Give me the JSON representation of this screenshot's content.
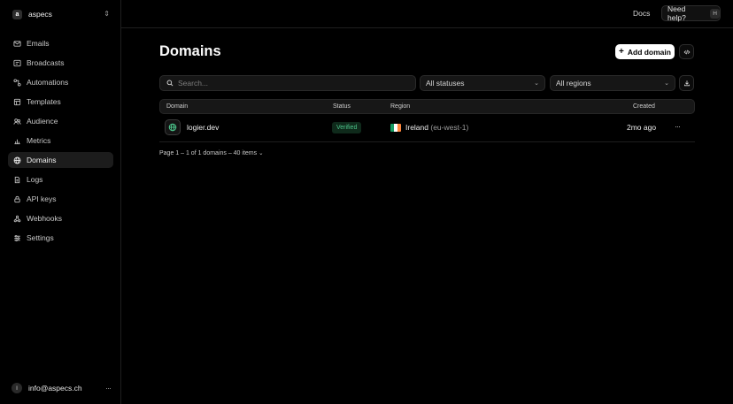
{
  "workspace": {
    "initial": "a",
    "name": "aspecs"
  },
  "sidebar": {
    "items": [
      {
        "label": "Emails",
        "icon": "mail-icon"
      },
      {
        "label": "Broadcasts",
        "icon": "broadcast-icon"
      },
      {
        "label": "Automations",
        "icon": "automation-icon"
      },
      {
        "label": "Templates",
        "icon": "template-icon"
      },
      {
        "label": "Audience",
        "icon": "users-icon"
      },
      {
        "label": "Metrics",
        "icon": "chart-icon"
      },
      {
        "label": "Domains",
        "icon": "globe-icon",
        "active": true
      },
      {
        "label": "Logs",
        "icon": "log-icon"
      },
      {
        "label": "API keys",
        "icon": "lock-icon"
      },
      {
        "label": "Webhooks",
        "icon": "webhook-icon"
      },
      {
        "label": "Settings",
        "icon": "sliders-icon"
      }
    ]
  },
  "user": {
    "initial": "I",
    "email": "info@aspecs.ch",
    "more": "···"
  },
  "header": {
    "docs": "Docs",
    "help": "Need help?",
    "help_key": "H"
  },
  "page": {
    "title": "Domains",
    "add_label": "Add domain",
    "search_placeholder": "Search...",
    "status_filter": "All statuses",
    "region_filter": "All regions"
  },
  "table": {
    "columns": {
      "domain": "Domain",
      "status": "Status",
      "region": "Region",
      "created": "Created"
    },
    "rows": [
      {
        "domain": "logier.dev",
        "status": "Verified",
        "region": "Ireland",
        "region_code": "(eu-west-1)",
        "created": "2mo ago",
        "more": "···"
      }
    ]
  },
  "pagination": {
    "text": "Page 1 – 1 of 1 domains – 40 items"
  },
  "colors": {
    "accent": "#ffffff",
    "verified_bg": "#0f2a1b",
    "verified_text": "#4cc38a",
    "active_nav": "#1c1c1c"
  }
}
